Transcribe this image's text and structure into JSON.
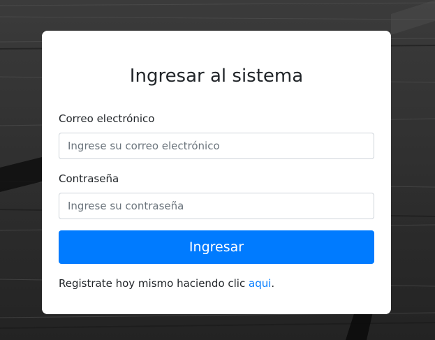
{
  "login": {
    "title": "Ingresar al sistema",
    "email_label": "Correo electrónico",
    "email_placeholder": "Ingrese su correo electrónico",
    "email_value": "",
    "password_label": "Contraseña",
    "password_placeholder": "Ingrese su contraseña",
    "password_value": "",
    "submit_label": "Ingresar",
    "register_text": "Registrate hoy mismo haciendo clic ",
    "register_link": "aqui",
    "register_suffix": "."
  },
  "colors": {
    "primary": "#007bff",
    "card_background": "#ffffff",
    "page_background": "#3a3a3a"
  }
}
